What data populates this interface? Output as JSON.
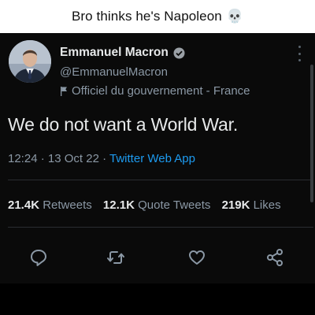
{
  "caption": {
    "text": "Bro thinks he's Napoleon",
    "emoji": "💀"
  },
  "tweet": {
    "author_name": "Emmanuel Macron",
    "handle": "@EmmanuelMacron",
    "account_label": "Officiel du gouvernement - France",
    "text": "We do not want a World War.",
    "time": "12:24",
    "date": "13 Oct 22",
    "separator": "·",
    "source": "Twitter Web App",
    "retweets_count": "21.4K",
    "retweets_label": "Retweets",
    "quotes_count": "12.1K",
    "quotes_label": "Quote Tweets",
    "likes_count": "219K",
    "likes_label": "Likes"
  },
  "icons": {
    "verified": "verified-badge-icon",
    "label": "government-flag-icon",
    "more": "more-options-icon",
    "reply": "reply-icon",
    "retweet": "retweet-icon",
    "like": "heart-icon",
    "share": "share-icon"
  },
  "colors": {
    "background": "#0a0a0a",
    "text_primary": "#e7e9ea",
    "text_secondary": "#8b98a5",
    "link": "#1d9bf0"
  }
}
